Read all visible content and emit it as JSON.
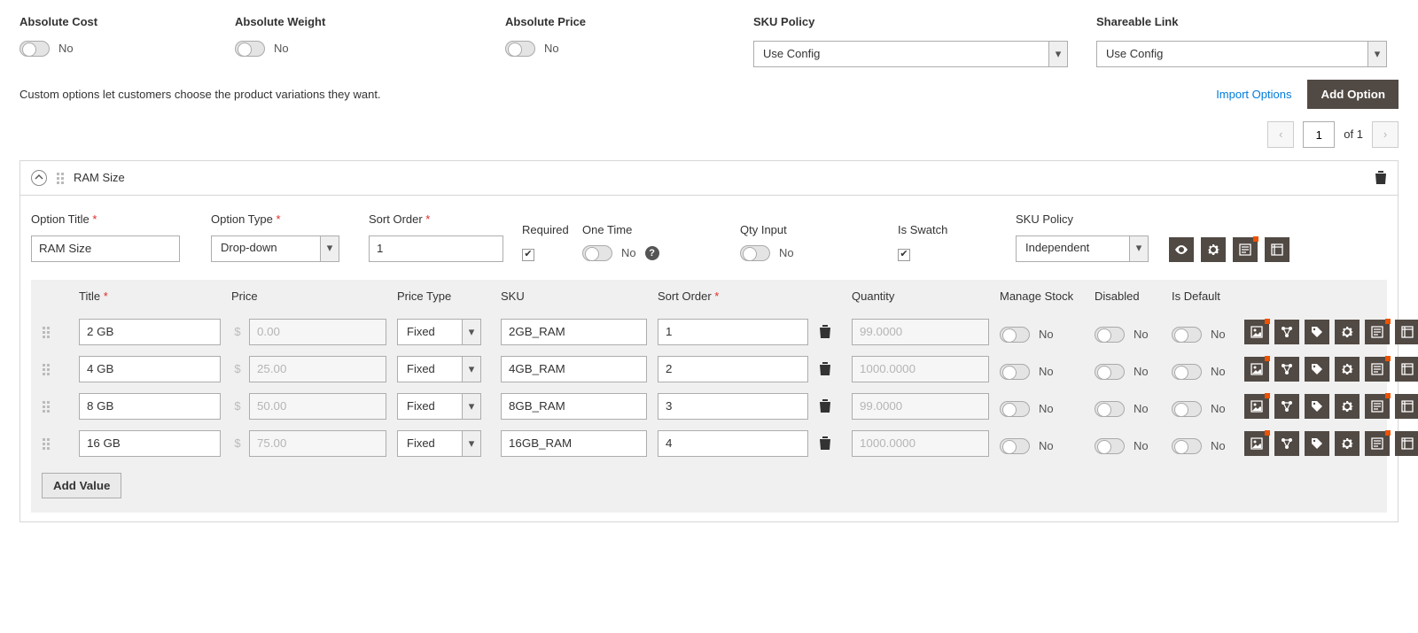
{
  "top": {
    "absolute_cost": {
      "label": "Absolute Cost",
      "value": "No"
    },
    "absolute_weight": {
      "label": "Absolute Weight",
      "value": "No"
    },
    "absolute_price": {
      "label": "Absolute Price",
      "value": "No"
    },
    "sku_policy": {
      "label": "SKU Policy",
      "value": "Use Config"
    },
    "shareable_link": {
      "label": "Shareable Link",
      "value": "Use Config"
    }
  },
  "hint": "Custom options let customers choose the product variations they want.",
  "actions": {
    "import": "Import Options",
    "add_option": "Add Option"
  },
  "pager": {
    "page": "1",
    "of_label": "of",
    "total": "1"
  },
  "option": {
    "title": "RAM Size",
    "fields": {
      "title": {
        "label": "Option Title",
        "value": "RAM Size"
      },
      "type": {
        "label": "Option Type",
        "value": "Drop-down"
      },
      "sort": {
        "label": "Sort Order",
        "value": "1"
      },
      "required": {
        "label": "Required",
        "checked": true
      },
      "one_time": {
        "label": "One Time",
        "value": "No"
      },
      "qty_input": {
        "label": "Qty Input",
        "value": "No"
      },
      "is_swatch": {
        "label": "Is Swatch",
        "checked": true
      },
      "sku_policy": {
        "label": "SKU Policy",
        "value": "Independent"
      }
    }
  },
  "values": {
    "headers": {
      "title": "Title",
      "price": "Price",
      "price_type": "Price Type",
      "sku": "SKU",
      "sort": "Sort Order",
      "qty": "Quantity",
      "manage": "Manage Stock",
      "disabled": "Disabled",
      "is_default": "Is Default"
    },
    "rows": [
      {
        "title": "2 GB",
        "price": "0.00",
        "price_type": "Fixed",
        "sku": "2GB_RAM",
        "sort": "1",
        "qty": "99.0000",
        "manage": "No",
        "disabled": "No",
        "is_default": "No"
      },
      {
        "title": "4 GB",
        "price": "25.00",
        "price_type": "Fixed",
        "sku": "4GB_RAM",
        "sort": "2",
        "qty": "1000.0000",
        "manage": "No",
        "disabled": "No",
        "is_default": "No"
      },
      {
        "title": "8 GB",
        "price": "50.00",
        "price_type": "Fixed",
        "sku": "8GB_RAM",
        "sort": "3",
        "qty": "99.0000",
        "manage": "No",
        "disabled": "No",
        "is_default": "No"
      },
      {
        "title": "16 GB",
        "price": "75.00",
        "price_type": "Fixed",
        "sku": "16GB_RAM",
        "sort": "4",
        "qty": "1000.0000",
        "manage": "No",
        "disabled": "No",
        "is_default": "No"
      }
    ],
    "add_value": "Add Value"
  }
}
